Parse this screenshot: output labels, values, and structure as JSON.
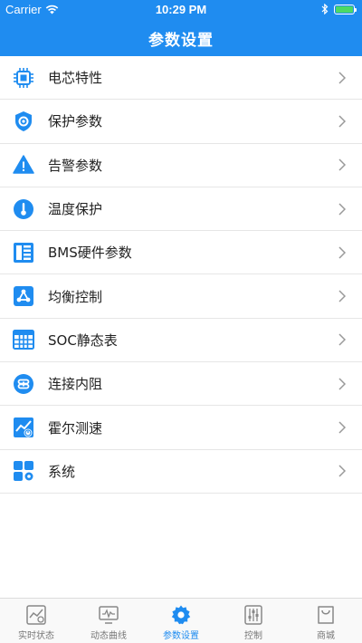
{
  "status_bar": {
    "carrier": "Carrier",
    "time": "10:29 PM"
  },
  "header": {
    "title": "参数设置"
  },
  "menu": {
    "items": [
      {
        "label": "电芯特性",
        "icon": "chip-icon"
      },
      {
        "label": "保护参数",
        "icon": "shield-gear-icon"
      },
      {
        "label": "告警参数",
        "icon": "warning-icon"
      },
      {
        "label": "温度保护",
        "icon": "thermometer-icon"
      },
      {
        "label": "BMS硬件参数",
        "icon": "hardware-list-icon"
      },
      {
        "label": "均衡控制",
        "icon": "balance-network-icon"
      },
      {
        "label": "SOC静态表",
        "icon": "table-icon"
      },
      {
        "label": "连接内阻",
        "icon": "link-resistance-icon"
      },
      {
        "label": "霍尔测速",
        "icon": "speed-chart-icon"
      },
      {
        "label": "系统",
        "icon": "system-grid-icon"
      }
    ]
  },
  "tabbar": {
    "tabs": [
      {
        "label": "实时状态",
        "icon": "realtime-chart-icon",
        "active": false
      },
      {
        "label": "动态曲线",
        "icon": "monitor-curve-icon",
        "active": false
      },
      {
        "label": "参数设置",
        "icon": "gear-icon",
        "active": true
      },
      {
        "label": "控制",
        "icon": "sliders-icon",
        "active": false
      },
      {
        "label": "商城",
        "icon": "shopping-bag-icon",
        "active": false
      }
    ]
  },
  "colors": {
    "accent": "#1f8cf0",
    "divider": "#e6e6e6",
    "battery": "#4cd964"
  }
}
